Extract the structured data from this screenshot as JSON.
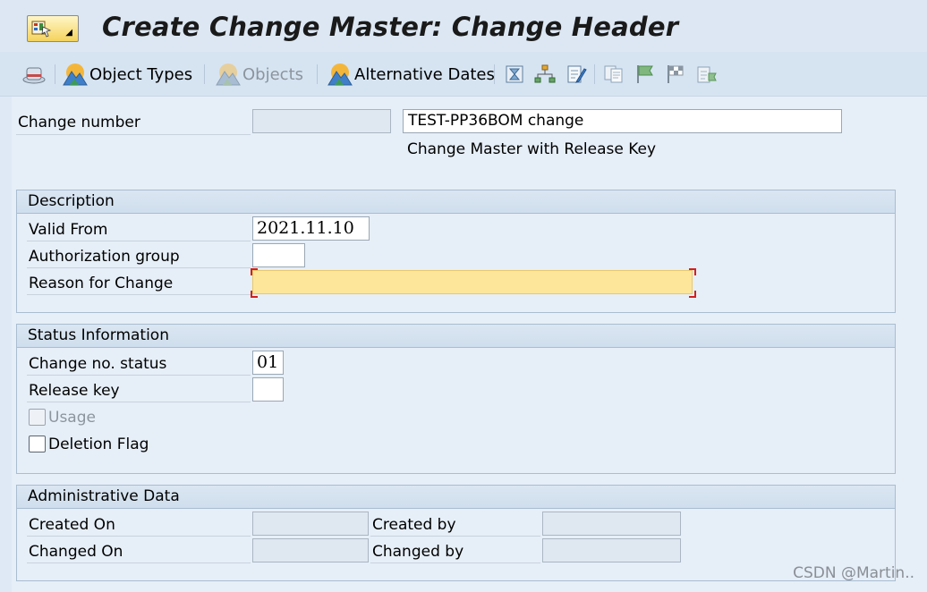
{
  "header": {
    "title": "Create Change Master: Change Header"
  },
  "toolbar": {
    "items": [
      {
        "label": "",
        "icon": "hat-icon",
        "enabled": true
      },
      {
        "label": "Object Types",
        "icon": "mountain-icon",
        "enabled": true
      },
      {
        "label": "Objects",
        "icon": "mountain-icon",
        "enabled": false
      },
      {
        "label": "Alternative Dates",
        "icon": "mountain-icon",
        "enabled": true
      }
    ]
  },
  "change": {
    "label": "Change number",
    "number": "",
    "description": "TEST-PP36BOM change",
    "type_text": "Change Master with Release Key"
  },
  "description_group": {
    "title": "Description",
    "valid_from_label": "Valid From",
    "valid_from": "2021.11.10",
    "auth_group_label": "Authorization group",
    "auth_group": "",
    "reason_label": "Reason for Change",
    "reason": ""
  },
  "status_group": {
    "title": "Status Information",
    "status_label": "Change no. status",
    "status": "01",
    "release_key_label": "Release key",
    "release_key": "",
    "usage_label": "Usage",
    "deletion_label": "Deletion Flag"
  },
  "admin_group": {
    "title": "Administrative Data",
    "created_on_label": "Created On",
    "created_on": "",
    "created_by_label": "Created by",
    "created_by": "",
    "changed_on_label": "Changed On",
    "changed_on": "",
    "changed_by_label": "Changed by",
    "changed_by": ""
  },
  "watermark": "CSDN @Martin.."
}
